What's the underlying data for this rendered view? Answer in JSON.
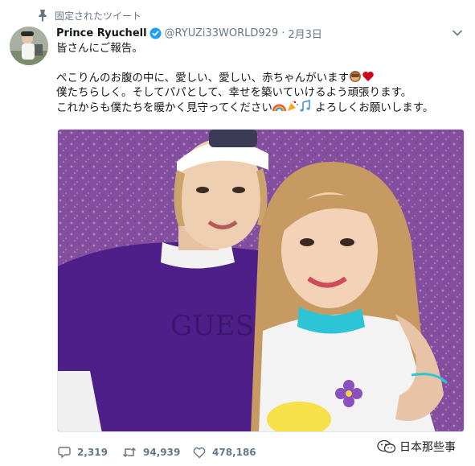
{
  "pinned": {
    "label": "固定されたツイート",
    "icon": "pin-icon"
  },
  "author": {
    "name": "Prince Ryuchell",
    "verified": true,
    "handle": "@RYUZi33WORLD929",
    "separator": "·",
    "date": "2月3日"
  },
  "tweet": {
    "line1": "皆さんにご報告。",
    "line2": "ぺこりんのお腹の中に、愛しい、愛しい、赤ちゃんがいます",
    "line3": "僕たちらしく。そしてパパとして、幸せを築いていけるよう頑張ります。",
    "line4a": "これからも僕たちを暖かく見守ってください",
    "line4b": "よろしくお願いします。",
    "emoji_line2": [
      "see-no-evil-monkey",
      "red-heart"
    ],
    "emoji_line4": [
      "rainbow",
      "party-popper",
      "musical-notes"
    ]
  },
  "media": {
    "description_icon": "photo"
  },
  "actions": {
    "reply_count": "2,319",
    "retweet_count": "94,939",
    "like_count": "478,186"
  },
  "watermark": {
    "text": "日本那些事",
    "icon": "wechat-icon"
  },
  "colors": {
    "text": "#14171a",
    "secondary": "#657786",
    "verified": "#1da1f2",
    "heart_emoji": "#d0021b",
    "photo_background": "#8e55a8",
    "shirt_purple": "#4f1f89"
  }
}
